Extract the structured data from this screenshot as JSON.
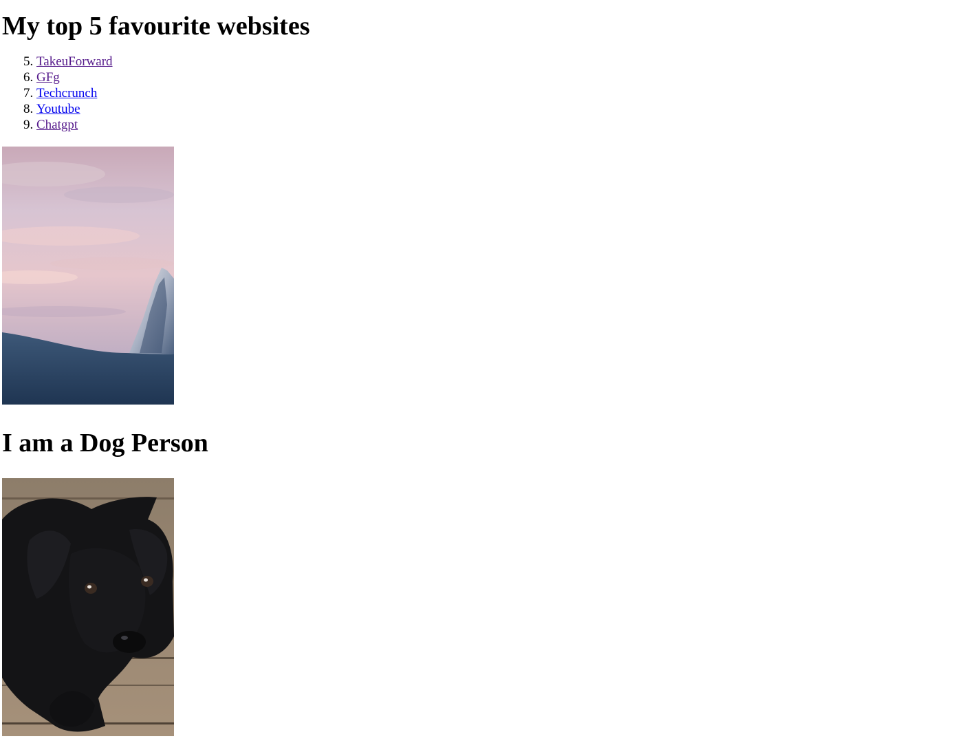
{
  "heading": "My top 5 favourite websites",
  "list": {
    "start": 5,
    "items": [
      {
        "label": "TakeuForward",
        "visited": true
      },
      {
        "label": "GFg",
        "visited": true
      },
      {
        "label": "Techcrunch",
        "visited": false
      },
      {
        "label": "Youtube",
        "visited": false
      },
      {
        "label": "Chatgpt",
        "visited": true
      }
    ]
  },
  "dog_heading": "I am a Dog Person",
  "colors": {
    "link": "#0000ee",
    "link_visited": "#551a8b"
  }
}
